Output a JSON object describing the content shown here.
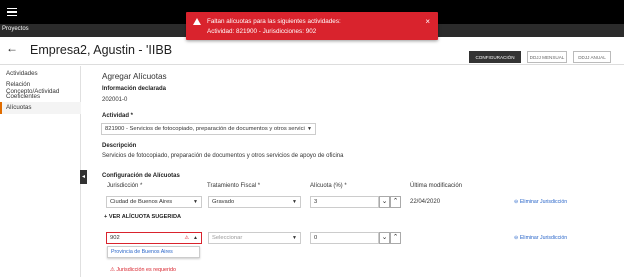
{
  "subnav": {
    "tab": "Proyectos"
  },
  "toast": {
    "line1": "Faltan alícuotas para las siguientes actividades:",
    "line2": "Actividad: 821900 - Jurisdicciones: 902",
    "close": "×"
  },
  "header": {
    "back": "←",
    "title": "Empresa2, Agustin - 'IIBB",
    "tabs": [
      "CONFIGURACIÓN",
      "DDJJ MENSUAL",
      "DDJJ ANUAL"
    ]
  },
  "sidebar": {
    "items": [
      "Actividades",
      "Relación Concepto/Actividad",
      "Coeficientes",
      "Alícuotas"
    ]
  },
  "content": {
    "title": "Agregar Alícuotas",
    "info_label": "Información declarada",
    "info_value": "202001-0",
    "actividad_label": "Actividad *",
    "actividad_value": "821900 - Servicios de fotocopiado, preparación de documentos y otros servici",
    "descripcion_label": "Descripción",
    "descripcion_value": "Servicios de fotocopiado, preparación de documentos y otros servicios de apoyo de oficina",
    "config_label": "Configuración de Alícuotas",
    "columns": {
      "jurisdiccion": "Jurisdicción *",
      "tratamiento": "Tratamiento Fiscal *",
      "alicuota": "Alícuota (%) *",
      "ultima": "Última modificación"
    },
    "row1": {
      "jurisdiccion": "Ciudad de Buenos Aires",
      "tratamiento": "Gravado",
      "alicuota": "3",
      "fecha": "22/04/2020",
      "eliminar": "Eliminar Jurisdicción"
    },
    "add_sugerida": "VER ALÍCUOTA SUGERIDA",
    "row2": {
      "jurisdiccion": "902",
      "tratamiento": "Seleccionar",
      "alicuota": "0",
      "eliminar": "Eliminar Jurisdicción",
      "dropdown_option": "Provincia de Buenos Aires",
      "error": "Jurisdicción es requerido"
    }
  },
  "colors": {
    "accent": "#e06c00",
    "error": "#d9232d",
    "link": "#2a66c9"
  }
}
